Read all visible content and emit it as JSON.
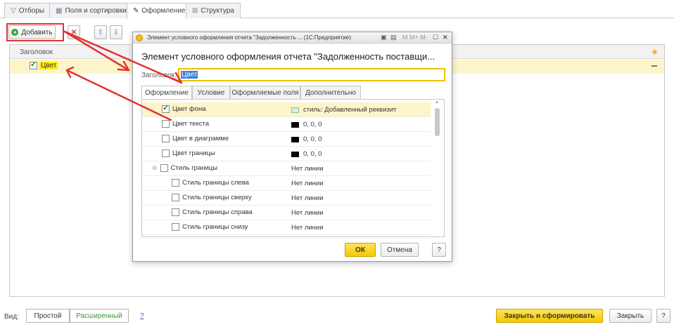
{
  "tabs": [
    {
      "label": "Отборы",
      "icon": "filter-icon"
    },
    {
      "label": "Поля и сортировки",
      "icon": "grid-icon"
    },
    {
      "label": "Оформление",
      "icon": "brush-icon"
    },
    {
      "label": "Структура",
      "icon": "structure-icon"
    }
  ],
  "toolbar": {
    "add_label": "Добавить"
  },
  "grid": {
    "header": "Заголовок",
    "row": {
      "label": "Цвет",
      "checked": true
    }
  },
  "bottom": {
    "view_label": "Вид:",
    "simple": "Простой",
    "advanced": "Расширенный",
    "help": "?",
    "close_build": "Закрыть и сформировать",
    "close": "Закрыть",
    "help2": "?"
  },
  "dialog": {
    "window_title": "Элемент условного оформления отчета \"Задолженность ... (1С:Предприятие)",
    "title": "Элемент условного оформления отчета \"Задолженность поставщи...",
    "caption_label": "Заголовок:",
    "caption_value": "Цвет",
    "tabs": [
      "Оформление",
      "Условие",
      "Оформляемые поля",
      "Дополнительно"
    ],
    "rows": [
      {
        "label": "Цвет фона",
        "checked": true,
        "value": "стиль: Добавленный реквизит",
        "swatch": "#d8f0d8"
      },
      {
        "label": "Цвет текста",
        "checked": false,
        "value": "0, 0, 0",
        "swatch": "#000000"
      },
      {
        "label": "Цвет в диаграмме",
        "checked": false,
        "value": "0, 0, 0",
        "swatch": "#000000"
      },
      {
        "label": "Цвет границы",
        "checked": false,
        "value": "0, 0, 0",
        "swatch": "#000000"
      },
      {
        "label": "Стиль границы",
        "checked": false,
        "value": "Нет линии"
      },
      {
        "label": "Стиль границы слева",
        "checked": false,
        "value": "Нет линии"
      },
      {
        "label": "Стиль границы сверху",
        "checked": false,
        "value": "Нет линии"
      },
      {
        "label": "Стиль границы справа",
        "checked": false,
        "value": "Нет линии"
      },
      {
        "label": "Стиль границы снизу",
        "checked": false,
        "value": "Нет линии"
      }
    ],
    "ok": "ОК",
    "cancel": "Отмена",
    "help": "?"
  },
  "colors": {
    "accent_yellow": "#f5c800",
    "annotation_red": "#e23232",
    "selection": "#fdf5c9"
  }
}
